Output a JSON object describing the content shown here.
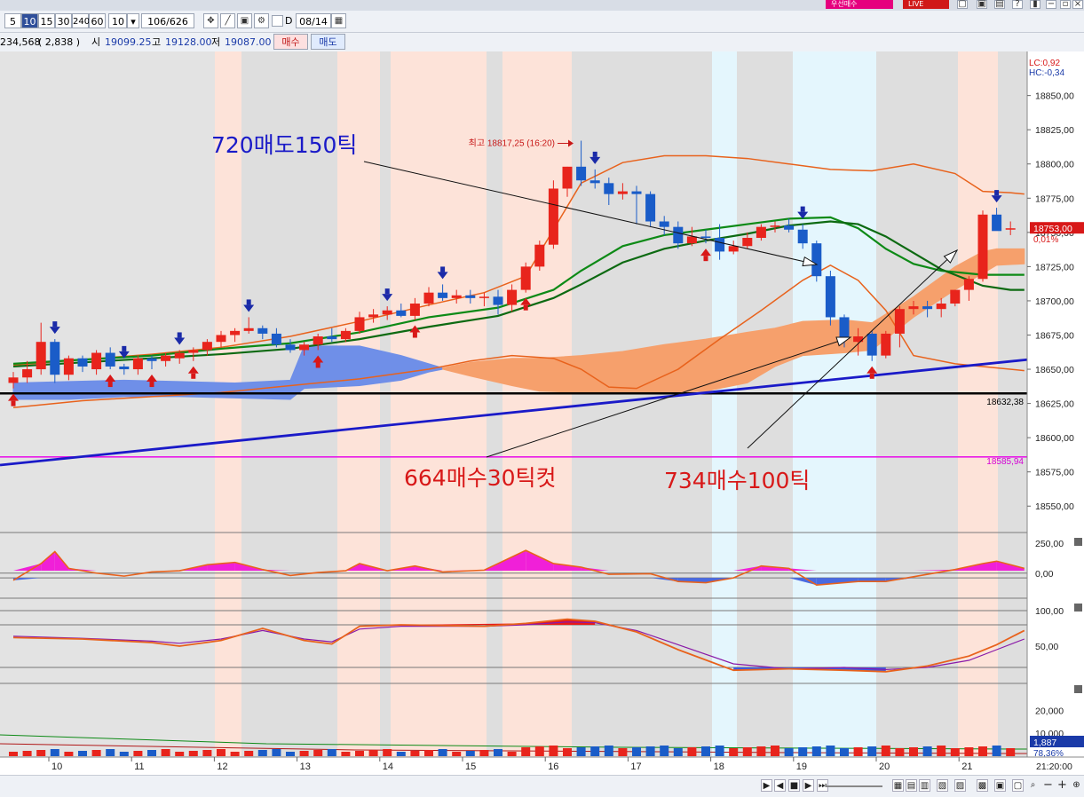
{
  "header": {
    "buy_badge": "우선매수",
    "live_badge": "LIVE",
    "period_buttons": [
      "5",
      "10",
      "15",
      "30",
      "240",
      "60"
    ],
    "active_period": "10",
    "count_value": "10",
    "view_position": "106",
    "view_total": "626",
    "d_label": "D",
    "date_value": "08/14"
  },
  "quote": {
    "volume": "234,568",
    "volume_change": "( 2,838 )",
    "open_label": "시",
    "open_value": "19099.25",
    "high_label": "고",
    "high_value": "19128.00",
    "low_label": "저",
    "low_value": "19087.00",
    "buy_button": "매수",
    "sell_button": "매도"
  },
  "chart_data": {
    "type": "candlestick",
    "price_range": [
      18532,
      18877
    ],
    "y_ticks": [
      18550,
      18575,
      18600,
      18625,
      18650,
      18675,
      18700,
      18725,
      18750,
      18775,
      18800,
      18825,
      18850
    ],
    "y_tick_labels": [
      "18550,00",
      "18575,00",
      "18600,00",
      "18625,00",
      "18650,00",
      "18675,00",
      "18700,00",
      "18725,00",
      "18750,00",
      "18775,00",
      "18800,00",
      "18825,00",
      "18850,00"
    ],
    "x_labels": [
      "10",
      "11",
      "12",
      "13",
      "14",
      "15",
      "16",
      "17",
      "18",
      "19",
      "20",
      "21"
    ],
    "time_label": "21:20:00",
    "candles": [
      [
        18640,
        18648,
        18636,
        18644
      ],
      [
        18644,
        18656,
        18640,
        18650
      ],
      [
        18650,
        18684,
        18646,
        18670
      ],
      [
        18670,
        18672,
        18640,
        18646
      ],
      [
        18646,
        18660,
        18642,
        18658
      ],
      [
        18658,
        18660,
        18648,
        18652
      ],
      [
        18650,
        18664,
        18646,
        18662
      ],
      [
        18662,
        18666,
        18650,
        18652
      ],
      [
        18652,
        18654,
        18646,
        18650
      ],
      [
        18650,
        18660,
        18646,
        18658
      ],
      [
        18658,
        18660,
        18650,
        18656
      ],
      [
        18656,
        18662,
        18652,
        18660
      ],
      [
        18658,
        18664,
        18654,
        18662
      ],
      [
        18662,
        18666,
        18656,
        18664
      ],
      [
        18664,
        18672,
        18660,
        18670
      ],
      [
        18670,
        18678,
        18666,
        18675
      ],
      [
        18675,
        18680,
        18670,
        18678
      ],
      [
        18678,
        18688,
        18676,
        18680
      ],
      [
        18680,
        18682,
        18672,
        18676
      ],
      [
        18676,
        18680,
        18666,
        18668
      ],
      [
        18668,
        18672,
        18662,
        18664
      ],
      [
        18664,
        18670,
        18660,
        18668
      ],
      [
        18668,
        18676,
        18664,
        18674
      ],
      [
        18674,
        18680,
        18670,
        18672
      ],
      [
        18672,
        18680,
        18670,
        18678
      ],
      [
        18678,
        18692,
        18676,
        18688
      ],
      [
        18688,
        18694,
        18684,
        18690
      ],
      [
        18690,
        18696,
        18686,
        18693
      ],
      [
        18693,
        18698,
        18688,
        18689
      ],
      [
        18689,
        18702,
        18686,
        18698
      ],
      [
        18698,
        18710,
        18696,
        18706
      ],
      [
        18706,
        18712,
        18700,
        18702
      ],
      [
        18702,
        18708,
        18698,
        18704
      ],
      [
        18704,
        18708,
        18698,
        18702
      ],
      [
        18702,
        18706,
        18696,
        18703
      ],
      [
        18703,
        18708,
        18690,
        18697
      ],
      [
        18697,
        18712,
        18692,
        18708
      ],
      [
        18708,
        18728,
        18706,
        18725
      ],
      [
        18725,
        18744,
        18722,
        18741
      ],
      [
        18741,
        18788,
        18738,
        18782
      ],
      [
        18782,
        18798,
        18776,
        18798
      ],
      [
        18798,
        18817,
        18784,
        18788
      ],
      [
        18788,
        18796,
        18782,
        18786
      ],
      [
        18786,
        18790,
        18770,
        18778
      ],
      [
        18778,
        18786,
        18774,
        18780
      ],
      [
        18780,
        18784,
        18756,
        18778
      ],
      [
        18778,
        18780,
        18754,
        18758
      ],
      [
        18758,
        18762,
        18748,
        18754
      ],
      [
        18754,
        18758,
        18738,
        18742
      ],
      [
        18742,
        18754,
        18740,
        18747
      ],
      [
        18747,
        18752,
        18742,
        18746
      ],
      [
        18746,
        18756,
        18730,
        18736
      ],
      [
        18736,
        18744,
        18734,
        18740
      ],
      [
        18740,
        18750,
        18738,
        18746
      ],
      [
        18746,
        18756,
        18744,
        18754
      ],
      [
        18754,
        18758,
        18750,
        18755
      ],
      [
        18755,
        18760,
        18750,
        18752
      ],
      [
        18752,
        18756,
        18738,
        18742
      ],
      [
        18742,
        18744,
        18714,
        18718
      ],
      [
        18718,
        18722,
        18682,
        18688
      ],
      [
        18688,
        18690,
        18666,
        18672
      ],
      [
        18670,
        18680,
        18660,
        18674
      ],
      [
        18676,
        18678,
        18656,
        18660
      ],
      [
        18660,
        18678,
        18658,
        18676
      ],
      [
        18676,
        18696,
        18666,
        18694
      ],
      [
        18694,
        18700,
        18690,
        18696
      ],
      [
        18696,
        18700,
        18688,
        18694
      ],
      [
        18694,
        18702,
        18688,
        18698
      ],
      [
        18698,
        18708,
        18696,
        18708
      ],
      [
        18708,
        18718,
        18700,
        18716
      ],
      [
        18716,
        18766,
        18714,
        18763
      ],
      [
        18763,
        18768,
        18752,
        18751
      ],
      [
        18752,
        18758,
        18748,
        18753
      ]
    ],
    "bollinger_upper": [
      [
        0,
        18653
      ],
      [
        5,
        18657
      ],
      [
        10,
        18661
      ],
      [
        15,
        18666
      ],
      [
        20,
        18674
      ],
      [
        25,
        18685
      ],
      [
        30,
        18697
      ],
      [
        34,
        18706
      ],
      [
        37,
        18718
      ],
      [
        39,
        18752
      ],
      [
        41,
        18786
      ],
      [
        44,
        18801
      ],
      [
        47,
        18806
      ],
      [
        50,
        18806
      ],
      [
        53,
        18804
      ],
      [
        56,
        18800
      ],
      [
        59,
        18796
      ],
      [
        62,
        18795
      ],
      [
        65,
        18800
      ],
      [
        68,
        18793
      ],
      [
        70,
        18780
      ],
      [
        72,
        18779
      ],
      [
        73,
        18778
      ]
    ],
    "bollinger_lower": [
      [
        0,
        18622
      ],
      [
        5,
        18627
      ],
      [
        10,
        18630
      ],
      [
        15,
        18633
      ],
      [
        20,
        18638
      ],
      [
        25,
        18643
      ],
      [
        30,
        18650
      ],
      [
        33,
        18656
      ],
      [
        36,
        18660
      ],
      [
        39,
        18658
      ],
      [
        41,
        18650
      ],
      [
        43,
        18637
      ],
      [
        45,
        18636
      ],
      [
        48,
        18650
      ],
      [
        51,
        18672
      ],
      [
        54,
        18693
      ],
      [
        57,
        18715
      ],
      [
        59,
        18726
      ],
      [
        61,
        18715
      ],
      [
        63,
        18693
      ],
      [
        65,
        18660
      ],
      [
        68,
        18654
      ],
      [
        70,
        18652
      ],
      [
        73,
        18649
      ]
    ],
    "ma_green_1": [
      [
        0,
        18654
      ],
      [
        5,
        18657
      ],
      [
        10,
        18660
      ],
      [
        15,
        18665
      ],
      [
        20,
        18669
      ],
      [
        25,
        18677
      ],
      [
        30,
        18688
      ],
      [
        35,
        18695
      ],
      [
        39,
        18708
      ],
      [
        41,
        18722
      ],
      [
        44,
        18740
      ],
      [
        47,
        18748
      ],
      [
        50,
        18752
      ],
      [
        53,
        18756
      ],
      [
        56,
        18760
      ],
      [
        59,
        18761
      ],
      [
        61,
        18753
      ],
      [
        63,
        18738
      ],
      [
        65,
        18727
      ],
      [
        67,
        18722
      ],
      [
        70,
        18719
      ],
      [
        72,
        18719
      ],
      [
        73,
        18719
      ]
    ],
    "ma_green_2": [
      [
        0,
        18652
      ],
      [
        5,
        18655
      ],
      [
        10,
        18658
      ],
      [
        15,
        18661
      ],
      [
        20,
        18665
      ],
      [
        25,
        18672
      ],
      [
        30,
        18681
      ],
      [
        35,
        18689
      ],
      [
        39,
        18702
      ],
      [
        41,
        18712
      ],
      [
        44,
        18728
      ],
      [
        47,
        18738
      ],
      [
        50,
        18744
      ],
      [
        53,
        18749
      ],
      [
        56,
        18755
      ],
      [
        59,
        18758
      ],
      [
        61,
        18756
      ],
      [
        63,
        18747
      ],
      [
        65,
        18735
      ],
      [
        67,
        18723
      ],
      [
        70,
        18711
      ],
      [
        72,
        18708
      ],
      [
        73,
        18708
      ]
    ],
    "cloud_blue": [
      [
        0,
        18640,
        18628
      ],
      [
        4,
        18641,
        18628
      ],
      [
        8,
        18642,
        18630
      ],
      [
        12,
        18641,
        18630
      ],
      [
        16,
        18640,
        18629
      ],
      [
        20,
        18642,
        18628
      ],
      [
        21,
        18667,
        18636
      ],
      [
        25,
        18667,
        18638
      ],
      [
        28,
        18660,
        18642
      ],
      [
        30,
        18654,
        18648
      ],
      [
        31,
        18651,
        18650
      ]
    ],
    "cloud_orange": [
      [
        31,
        18651,
        18650
      ],
      [
        33,
        18655,
        18645
      ],
      [
        36,
        18658,
        18638
      ],
      [
        38,
        18658,
        18634
      ],
      [
        41,
        18660,
        18633
      ],
      [
        44,
        18663,
        18633
      ],
      [
        47,
        18668,
        18633
      ],
      [
        50,
        18672,
        18634
      ],
      [
        53,
        18677,
        18640
      ],
      [
        55,
        18680,
        18652
      ],
      [
        57,
        18685,
        18660
      ],
      [
        60,
        18686,
        18662
      ],
      [
        62,
        18684,
        18664
      ],
      [
        65,
        18703,
        18688
      ],
      [
        68,
        18725,
        18708
      ],
      [
        70,
        18736,
        18720
      ],
      [
        71,
        18738,
        18726
      ],
      [
        73,
        18738,
        18727
      ]
    ],
    "markers_down": [
      3,
      8,
      12,
      17,
      27,
      31,
      42,
      57,
      71
    ],
    "markers_up": [
      0,
      7,
      10,
      13,
      22,
      29,
      37,
      50,
      62
    ],
    "high_annotation": "최고 18817,25 (16:20)",
    "horizontal_black": 18632.38,
    "horizontal_black_label": "18632,38",
    "horizontal_magenta": 18585.94,
    "horizontal_magenta_label": "18585,94",
    "trendline": [
      [
        0,
        18580
      ],
      [
        73,
        18657
      ]
    ],
    "current_price_label": "18753,00",
    "current_change_label": "0,01%",
    "lc_label": "LC:0,92",
    "hc_label": "HC:-0,34",
    "annotations": [
      {
        "text": "720매도150틱"
      },
      {
        "text": "664매수30틱컷"
      },
      {
        "text": "734매수100틱"
      }
    ],
    "panel1": {
      "range": [
        -180,
        310
      ],
      "labels": [
        "250,00",
        "0,00"
      ],
      "line": [
        [
          0,
          -60
        ],
        [
          2,
          80
        ],
        [
          3,
          180
        ],
        [
          4,
          40
        ],
        [
          6,
          0
        ],
        [
          8,
          -25
        ],
        [
          10,
          10
        ],
        [
          12,
          20
        ],
        [
          14,
          70
        ],
        [
          16,
          90
        ],
        [
          18,
          30
        ],
        [
          20,
          -20
        ],
        [
          22,
          5
        ],
        [
          24,
          20
        ],
        [
          25,
          80
        ],
        [
          27,
          20
        ],
        [
          29,
          60
        ],
        [
          31,
          10
        ],
        [
          34,
          25
        ],
        [
          37,
          190
        ],
        [
          39,
          80
        ],
        [
          41,
          50
        ],
        [
          43,
          -10
        ],
        [
          46,
          -5
        ],
        [
          48,
          -70
        ],
        [
          50,
          -80
        ],
        [
          52,
          -40
        ],
        [
          54,
          60
        ],
        [
          56,
          40
        ],
        [
          58,
          -100
        ],
        [
          61,
          -70
        ],
        [
          63,
          -70
        ],
        [
          65,
          -30
        ],
        [
          68,
          30
        ],
        [
          70,
          80
        ],
        [
          71,
          100
        ],
        [
          73,
          40
        ]
      ]
    },
    "panel2": {
      "range": [
        0,
        115
      ],
      "labels": [
        "100,00",
        "50,00"
      ],
      "orange": [
        [
          0,
          62
        ],
        [
          5,
          60
        ],
        [
          10,
          55
        ],
        [
          12,
          50
        ],
        [
          15,
          58
        ],
        [
          18,
          75
        ],
        [
          21,
          58
        ],
        [
          23,
          53
        ],
        [
          25,
          78
        ],
        [
          28,
          80
        ],
        [
          34,
          78
        ],
        [
          37,
          82
        ],
        [
          40,
          88
        ],
        [
          42,
          85
        ],
        [
          45,
          70
        ],
        [
          48,
          45
        ],
        [
          52,
          16
        ],
        [
          56,
          18
        ],
        [
          60,
          16
        ],
        [
          63,
          14
        ],
        [
          66,
          22
        ],
        [
          69,
          36
        ],
        [
          71,
          52
        ],
        [
          73,
          72
        ]
      ],
      "purple": [
        [
          0,
          64
        ],
        [
          5,
          61
        ],
        [
          10,
          57
        ],
        [
          12,
          54
        ],
        [
          15,
          60
        ],
        [
          18,
          72
        ],
        [
          21,
          60
        ],
        [
          23,
          56
        ],
        [
          25,
          74
        ],
        [
          28,
          78
        ],
        [
          34,
          78
        ],
        [
          37,
          80
        ],
        [
          40,
          84
        ],
        [
          42,
          83
        ],
        [
          45,
          72
        ],
        [
          48,
          52
        ],
        [
          52,
          25
        ],
        [
          56,
          18
        ],
        [
          60,
          20
        ],
        [
          63,
          17
        ],
        [
          66,
          20
        ],
        [
          69,
          30
        ],
        [
          71,
          45
        ],
        [
          73,
          60
        ]
      ]
    },
    "panel3": {
      "range": [
        0,
        31000
      ],
      "labels": [
        "20,000",
        "10,000"
      ],
      "volume_label": "1,887",
      "ratio_label": "78,36%"
    }
  },
  "footer": {
    "zoom_minus": "−",
    "zoom_plus": "+"
  }
}
